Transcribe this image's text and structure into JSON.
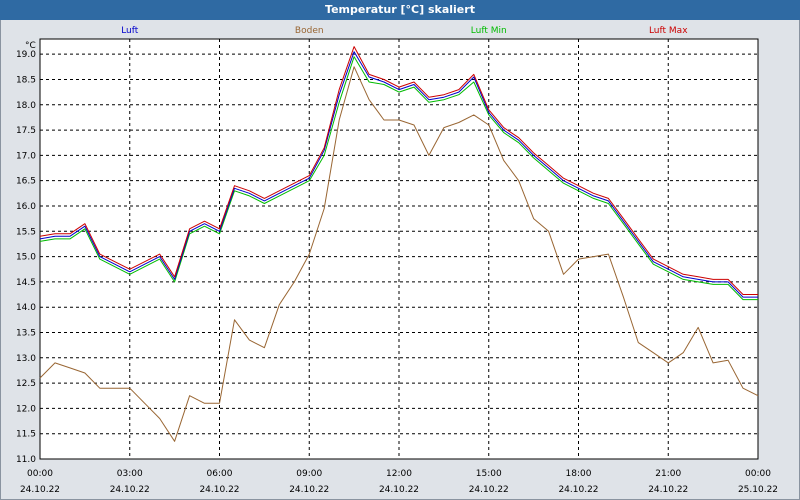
{
  "chart_data": {
    "type": "line",
    "title": "Temperatur [°C] skaliert",
    "ylabel": "°C",
    "ylim": [
      11.0,
      19.3
    ],
    "yticks": [
      11.0,
      11.5,
      12.0,
      12.5,
      13.0,
      13.5,
      14.0,
      14.5,
      15.0,
      15.5,
      16.0,
      16.5,
      17.0,
      17.5,
      18.0,
      18.5,
      19.0
    ],
    "xlim": [
      0,
      24
    ],
    "xticks": [
      {
        "h": 0,
        "time": "00:00",
        "date": "24.10.22"
      },
      {
        "h": 3,
        "time": "03:00",
        "date": "24.10.22"
      },
      {
        "h": 6,
        "time": "06:00",
        "date": "24.10.22"
      },
      {
        "h": 9,
        "time": "09:00",
        "date": "24.10.22"
      },
      {
        "h": 12,
        "time": "12:00",
        "date": "24.10.22"
      },
      {
        "h": 15,
        "time": "15:00",
        "date": "24.10.22"
      },
      {
        "h": 18,
        "time": "18:00",
        "date": "24.10.22"
      },
      {
        "h": 21,
        "time": "21:00",
        "date": "24.10.22"
      },
      {
        "h": 24,
        "time": "00:00",
        "date": "25.10.22"
      }
    ],
    "grid": true,
    "legend_position": "top",
    "x": [
      0,
      0.5,
      1,
      1.5,
      2,
      2.5,
      3,
      3.5,
      4,
      4.5,
      5,
      5.5,
      6,
      6.5,
      7,
      7.5,
      8,
      8.5,
      9,
      9.5,
      10,
      10.5,
      11,
      11.5,
      12,
      12.5,
      13,
      13.5,
      14,
      14.5,
      15,
      15.5,
      16,
      16.5,
      17,
      17.5,
      18,
      18.5,
      19,
      19.5,
      20,
      20.5,
      21,
      21.5,
      22,
      22.5,
      23,
      23.5,
      24
    ],
    "series": [
      {
        "name": "Luft",
        "color": "#0000cc",
        "values": [
          15.35,
          15.4,
          15.4,
          15.6,
          15.0,
          14.85,
          14.7,
          14.85,
          15.0,
          14.55,
          15.5,
          15.65,
          15.5,
          16.35,
          16.25,
          16.1,
          16.25,
          16.4,
          16.55,
          17.1,
          18.2,
          19.05,
          18.55,
          18.45,
          18.3,
          18.4,
          18.1,
          18.15,
          18.25,
          18.55,
          17.85,
          17.5,
          17.3,
          17.0,
          16.75,
          16.5,
          16.35,
          16.2,
          16.1,
          15.7,
          15.3,
          14.9,
          14.75,
          14.6,
          14.55,
          14.5,
          14.5,
          14.2,
          14.2
        ]
      },
      {
        "name": "Boden",
        "color": "#996633",
        "values": [
          12.6,
          12.9,
          12.8,
          12.7,
          12.4,
          12.4,
          12.4,
          12.1,
          11.8,
          11.35,
          12.25,
          12.1,
          12.1,
          13.75,
          13.35,
          13.2,
          14.05,
          14.5,
          15.05,
          15.95,
          17.7,
          18.75,
          18.1,
          17.7,
          17.7,
          17.6,
          17.0,
          17.55,
          17.65,
          17.8,
          17.6,
          16.9,
          16.5,
          15.75,
          15.5,
          14.65,
          14.95,
          15.0,
          15.05,
          14.2,
          13.3,
          13.1,
          12.9,
          13.1,
          13.6,
          12.9,
          12.95,
          12.4,
          12.25
        ]
      },
      {
        "name": "Luft Min",
        "color": "#00bb00",
        "values": [
          15.3,
          15.35,
          15.35,
          15.55,
          14.95,
          14.8,
          14.65,
          14.8,
          14.95,
          14.5,
          15.45,
          15.6,
          15.45,
          16.3,
          16.2,
          16.05,
          16.2,
          16.35,
          16.5,
          17.0,
          18.05,
          18.95,
          18.45,
          18.4,
          18.25,
          18.35,
          18.05,
          18.1,
          18.2,
          18.45,
          17.8,
          17.45,
          17.25,
          16.95,
          16.7,
          16.45,
          16.3,
          16.15,
          16.05,
          15.65,
          15.25,
          14.85,
          14.7,
          14.55,
          14.5,
          14.45,
          14.45,
          14.15,
          14.15
        ]
      },
      {
        "name": "Luft Max",
        "color": "#cc0000",
        "values": [
          15.4,
          15.45,
          15.45,
          15.65,
          15.05,
          14.9,
          14.75,
          14.9,
          15.05,
          14.6,
          15.55,
          15.7,
          15.55,
          16.4,
          16.3,
          16.15,
          16.3,
          16.45,
          16.6,
          17.15,
          18.3,
          19.15,
          18.6,
          18.5,
          18.35,
          18.45,
          18.15,
          18.2,
          18.3,
          18.6,
          17.9,
          17.55,
          17.35,
          17.05,
          16.8,
          16.55,
          16.4,
          16.25,
          16.15,
          15.75,
          15.35,
          14.95,
          14.8,
          14.65,
          14.6,
          14.55,
          14.55,
          14.25,
          14.25
        ]
      }
    ]
  }
}
